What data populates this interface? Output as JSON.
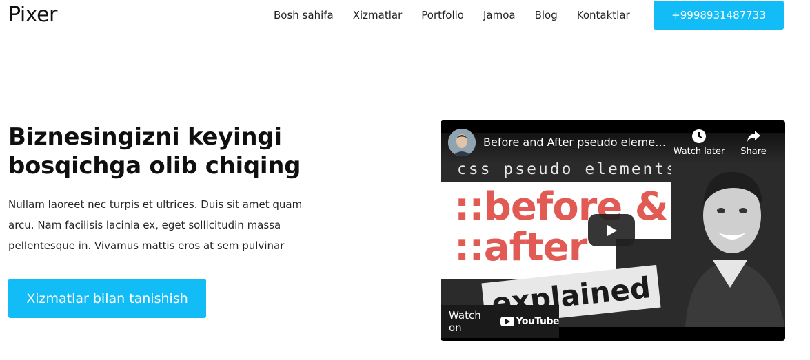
{
  "header": {
    "logo": "Pixer",
    "nav": [
      "Bosh sahifa",
      "Xizmatlar",
      "Portfolio",
      "Jamoa",
      "Blog",
      "Kontaktlar"
    ],
    "phone": "+9998931487733"
  },
  "hero": {
    "title": "Biznesingizni keyingi bosqichga olib chiqing",
    "text": "Nullam laoreet nec turpis et ultrices. Duis sit amet quam arcu. Nam facilisis lacinia ex, eget sollicitudin massa pellentesque in. Vivamus mattis eros at sem pulvinar",
    "cta": "Xizmatlar bilan tanishish"
  },
  "video": {
    "title": "Before and After pseudo eleme…",
    "watch_later": "Watch later",
    "share": "Share",
    "watch_on": "Watch on",
    "youtube": "YouTube",
    "thumb_line1": "css pseudo elements",
    "thumb_line2": "::before &",
    "thumb_line3": "::after",
    "thumb_line4": "explained"
  },
  "colors": {
    "accent": "#12bdf7",
    "thumb_red": "#e15a53"
  }
}
